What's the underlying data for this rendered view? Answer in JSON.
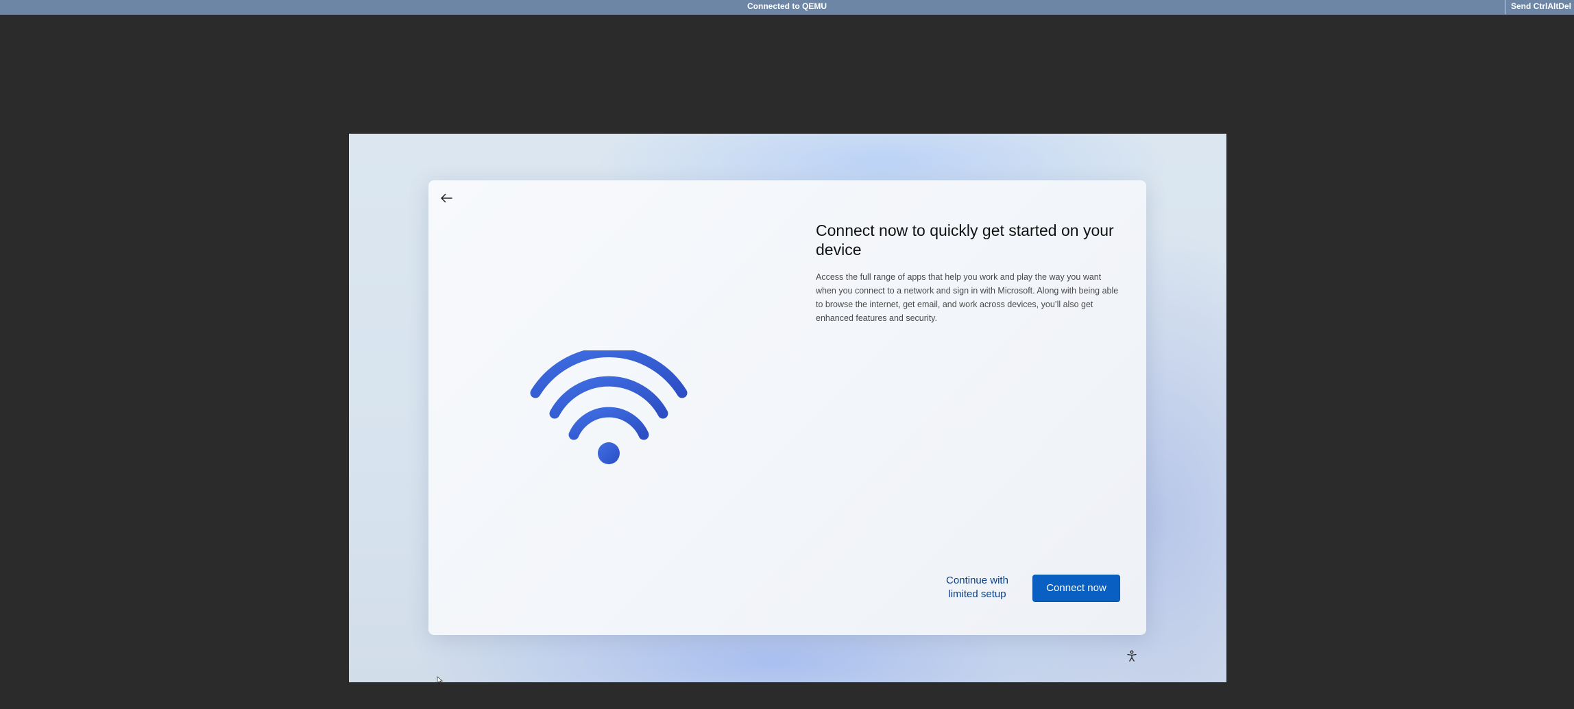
{
  "viewer": {
    "title": "Connected to QEMU",
    "send_cad_label": "Send CtrlAltDel"
  },
  "setup": {
    "back_icon": "arrow-left-icon",
    "illustration_icon": "wifi-icon",
    "heading": "Connect now to quickly get started on your device",
    "description": "Access the full range of apps that help you work and play the way you want when you connect to a network and sign in with Microsoft. Along with being able to browse the internet, get email, and work across devices, you’ll also get enhanced features and security.",
    "secondary_button": "Continue with limited setup",
    "primary_button": "Connect now",
    "accessibility_icon": "accessibility-icon"
  },
  "colors": {
    "accent": "#0a5fc2",
    "wifi_start": "#3a66de",
    "wifi_end": "#2f50c8",
    "viewer_bar": "#6e86a6"
  }
}
